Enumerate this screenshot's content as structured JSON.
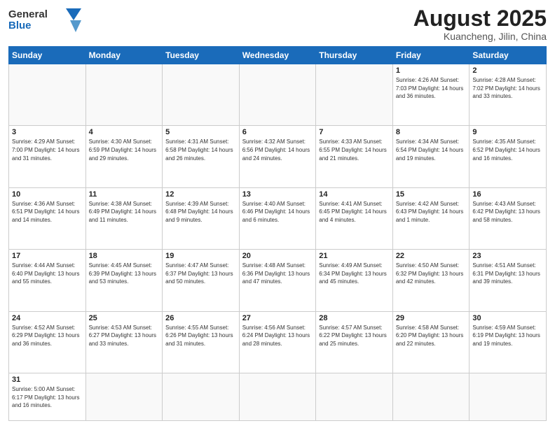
{
  "logo": {
    "text_general": "General",
    "text_blue": "Blue"
  },
  "title": "August 2025",
  "location": "Kuancheng, Jilin, China",
  "weekdays": [
    "Sunday",
    "Monday",
    "Tuesday",
    "Wednesday",
    "Thursday",
    "Friday",
    "Saturday"
  ],
  "weeks": [
    [
      {
        "day": "",
        "info": ""
      },
      {
        "day": "",
        "info": ""
      },
      {
        "day": "",
        "info": ""
      },
      {
        "day": "",
        "info": ""
      },
      {
        "day": "",
        "info": ""
      },
      {
        "day": "1",
        "info": "Sunrise: 4:26 AM\nSunset: 7:03 PM\nDaylight: 14 hours and 36 minutes."
      },
      {
        "day": "2",
        "info": "Sunrise: 4:28 AM\nSunset: 7:02 PM\nDaylight: 14 hours and 33 minutes."
      }
    ],
    [
      {
        "day": "3",
        "info": "Sunrise: 4:29 AM\nSunset: 7:00 PM\nDaylight: 14 hours and 31 minutes."
      },
      {
        "day": "4",
        "info": "Sunrise: 4:30 AM\nSunset: 6:59 PM\nDaylight: 14 hours and 29 minutes."
      },
      {
        "day": "5",
        "info": "Sunrise: 4:31 AM\nSunset: 6:58 PM\nDaylight: 14 hours and 26 minutes."
      },
      {
        "day": "6",
        "info": "Sunrise: 4:32 AM\nSunset: 6:56 PM\nDaylight: 14 hours and 24 minutes."
      },
      {
        "day": "7",
        "info": "Sunrise: 4:33 AM\nSunset: 6:55 PM\nDaylight: 14 hours and 21 minutes."
      },
      {
        "day": "8",
        "info": "Sunrise: 4:34 AM\nSunset: 6:54 PM\nDaylight: 14 hours and 19 minutes."
      },
      {
        "day": "9",
        "info": "Sunrise: 4:35 AM\nSunset: 6:52 PM\nDaylight: 14 hours and 16 minutes."
      }
    ],
    [
      {
        "day": "10",
        "info": "Sunrise: 4:36 AM\nSunset: 6:51 PM\nDaylight: 14 hours and 14 minutes."
      },
      {
        "day": "11",
        "info": "Sunrise: 4:38 AM\nSunset: 6:49 PM\nDaylight: 14 hours and 11 minutes."
      },
      {
        "day": "12",
        "info": "Sunrise: 4:39 AM\nSunset: 6:48 PM\nDaylight: 14 hours and 9 minutes."
      },
      {
        "day": "13",
        "info": "Sunrise: 4:40 AM\nSunset: 6:46 PM\nDaylight: 14 hours and 6 minutes."
      },
      {
        "day": "14",
        "info": "Sunrise: 4:41 AM\nSunset: 6:45 PM\nDaylight: 14 hours and 4 minutes."
      },
      {
        "day": "15",
        "info": "Sunrise: 4:42 AM\nSunset: 6:43 PM\nDaylight: 14 hours and 1 minute."
      },
      {
        "day": "16",
        "info": "Sunrise: 4:43 AM\nSunset: 6:42 PM\nDaylight: 13 hours and 58 minutes."
      }
    ],
    [
      {
        "day": "17",
        "info": "Sunrise: 4:44 AM\nSunset: 6:40 PM\nDaylight: 13 hours and 55 minutes."
      },
      {
        "day": "18",
        "info": "Sunrise: 4:45 AM\nSunset: 6:39 PM\nDaylight: 13 hours and 53 minutes."
      },
      {
        "day": "19",
        "info": "Sunrise: 4:47 AM\nSunset: 6:37 PM\nDaylight: 13 hours and 50 minutes."
      },
      {
        "day": "20",
        "info": "Sunrise: 4:48 AM\nSunset: 6:36 PM\nDaylight: 13 hours and 47 minutes."
      },
      {
        "day": "21",
        "info": "Sunrise: 4:49 AM\nSunset: 6:34 PM\nDaylight: 13 hours and 45 minutes."
      },
      {
        "day": "22",
        "info": "Sunrise: 4:50 AM\nSunset: 6:32 PM\nDaylight: 13 hours and 42 minutes."
      },
      {
        "day": "23",
        "info": "Sunrise: 4:51 AM\nSunset: 6:31 PM\nDaylight: 13 hours and 39 minutes."
      }
    ],
    [
      {
        "day": "24",
        "info": "Sunrise: 4:52 AM\nSunset: 6:29 PM\nDaylight: 13 hours and 36 minutes."
      },
      {
        "day": "25",
        "info": "Sunrise: 4:53 AM\nSunset: 6:27 PM\nDaylight: 13 hours and 33 minutes."
      },
      {
        "day": "26",
        "info": "Sunrise: 4:55 AM\nSunset: 6:26 PM\nDaylight: 13 hours and 31 minutes."
      },
      {
        "day": "27",
        "info": "Sunrise: 4:56 AM\nSunset: 6:24 PM\nDaylight: 13 hours and 28 minutes."
      },
      {
        "day": "28",
        "info": "Sunrise: 4:57 AM\nSunset: 6:22 PM\nDaylight: 13 hours and 25 minutes."
      },
      {
        "day": "29",
        "info": "Sunrise: 4:58 AM\nSunset: 6:20 PM\nDaylight: 13 hours and 22 minutes."
      },
      {
        "day": "30",
        "info": "Sunrise: 4:59 AM\nSunset: 6:19 PM\nDaylight: 13 hours and 19 minutes."
      }
    ],
    [
      {
        "day": "31",
        "info": "Sunrise: 5:00 AM\nSunset: 6:17 PM\nDaylight: 13 hours and 16 minutes."
      },
      {
        "day": "",
        "info": ""
      },
      {
        "day": "",
        "info": ""
      },
      {
        "day": "",
        "info": ""
      },
      {
        "day": "",
        "info": ""
      },
      {
        "day": "",
        "info": ""
      },
      {
        "day": "",
        "info": ""
      }
    ]
  ]
}
